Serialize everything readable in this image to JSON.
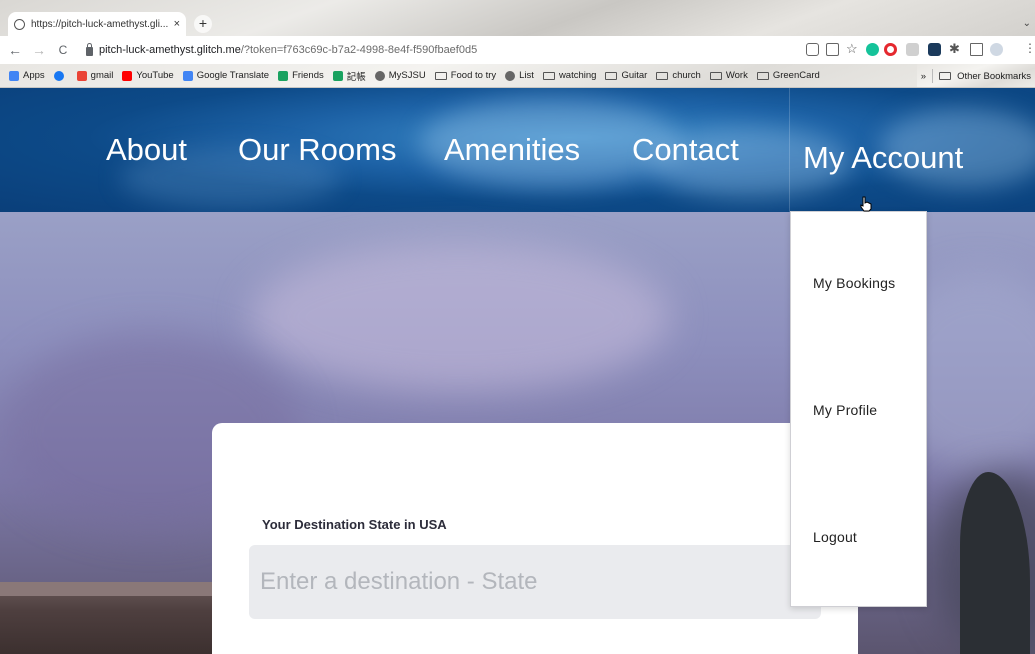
{
  "browser": {
    "tab_title": "https://pitch-luck-amethyst.gli...",
    "tab_close": "×",
    "new_tab": "+",
    "tab_menu": "⌄",
    "url_host": "pitch-luck-amethyst.glitch.me",
    "url_rest": "/?token=f763c69c-b7a2-4998-8e4f-f590fbaef0d5",
    "back": "←",
    "forward": "→",
    "reload": "C"
  },
  "bookmarks": {
    "items": [
      {
        "label": "Apps",
        "icon": "apps-grid-icon",
        "color": "#4285f4"
      },
      {
        "label": "",
        "icon": "facebook-icon",
        "color": "#1877f2"
      },
      {
        "label": "gmail",
        "icon": "gmail-icon",
        "color": "#ea4335"
      },
      {
        "label": "YouTube",
        "icon": "youtube-icon",
        "color": "#ff0000"
      },
      {
        "label": "Google Translate",
        "icon": "translate-icon",
        "color": "#4285f4"
      },
      {
        "label": "Friends",
        "icon": "plus-green-icon",
        "color": "#1aa260"
      },
      {
        "label": "記帳",
        "icon": "plus-green-icon",
        "color": "#1aa260"
      },
      {
        "label": "MySJSU",
        "icon": "globe-icon",
        "color": "#666666"
      },
      {
        "label": "Food to try",
        "icon": "folder-icon",
        "color": ""
      },
      {
        "label": "List",
        "icon": "globe-icon",
        "color": "#666666"
      },
      {
        "label": "watching",
        "icon": "folder-icon",
        "color": ""
      },
      {
        "label": "Guitar",
        "icon": "folder-icon",
        "color": ""
      },
      {
        "label": "church",
        "icon": "folder-icon",
        "color": ""
      },
      {
        "label": "Work",
        "icon": "folder-icon",
        "color": ""
      },
      {
        "label": "GreenCard",
        "icon": "folder-icon",
        "color": ""
      }
    ],
    "overflow": "»",
    "other": "Other Bookmarks"
  },
  "nav": {
    "about": "About",
    "rooms": "Our Rooms",
    "amenities": "Amenities",
    "contact": "Contact",
    "account": "My Account"
  },
  "account_menu": {
    "bookings": "My Bookings",
    "profile": "My Profile",
    "logout": "Logout"
  },
  "search": {
    "label": "Your Destination State in USA",
    "placeholder": "Enter a destination - State"
  },
  "colors": {
    "nav_bg": "#0d4a88",
    "input_bg": "#eaebee",
    "label_text": "#2c2c3a"
  }
}
